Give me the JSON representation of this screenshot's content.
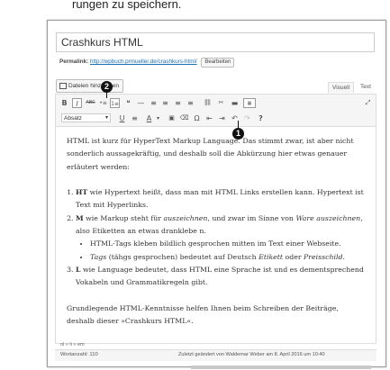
{
  "top_text": "rungen zu speichern.",
  "post": {
    "title": "Crashkurs HTML",
    "permalink_label": "Permalink:",
    "permalink_url": "http://wpbuch.prmueller.de/crashkurs-html/",
    "edit_label": "Bearbeiten"
  },
  "media_button": "Dateien hinzufügen",
  "tabs": {
    "visual": "Visuell",
    "text": "Text"
  },
  "toolbar": {
    "row1": [
      "B",
      "I",
      "ABC",
      "•≡",
      "1≡",
      "❝",
      "—",
      "≡",
      "≡",
      "≡",
      "🔗",
      "⛓",
      "▬",
      "⌨"
    ],
    "format_select": "Absatz",
    "row2": [
      "U",
      "≡",
      "A",
      "▾",
      "📋",
      "✎",
      "Ω",
      "⇤",
      "⇥",
      "↶",
      "↷",
      "?"
    ]
  },
  "callouts": {
    "one": "1",
    "two": "2"
  },
  "content": {
    "intro": "HTML ist kurz für HyperText Markup Language. Das stimmt zwar, ist aber nicht sonderlich aussagekräftig, und deshalb soll die Abkürzung hier etwas genauer erläutert werden:",
    "items": [
      {
        "bold": "HT",
        "text": " wie Hypertext heißt, dass man mit HTML Links erstellen kann. Hypertext ist Text mit Hyperlinks."
      },
      {
        "bold": "M",
        "text": " wie Markup steht für auszeichnen, und zwar im Sinne von Ware auszeichnen, also Etiketten an etwas drankleben."
      },
      {
        "bold": "L",
        "text": " wie Language bedeutet, dass HTML eine Sprache ist und es dementsprechend Vokabeln und Grammatikregeln gibt."
      }
    ],
    "m_part1": " wie Markup steht für ",
    "m_em1": "auszeichnen",
    "m_part2": ", und zwar im Sinne von ",
    "m_em2": "Ware auszeichnen",
    "m_part3": ", also Etiketten an etwas dranklebe n.",
    "sub1": "HTML-Tags kleben bildlich gesprochen mitten im Text einer Webseite.",
    "sub2_em": "Tags",
    "sub2_a": " (tähgs gesprochen) bedeutet auf Deutsch ",
    "sub2_em2": "Etikett",
    "sub2_b": " oder ",
    "sub2_em3": "Preisschild",
    "sub2_c": ".",
    "outro": "Grundlegende HTML-Kenntnisse helfen Ihnen beim Schreiben der Beiträge, deshalb dieser »Crashkurs HTML«."
  },
  "status": {
    "path": "ol » li » em",
    "word_count": "Wortanzahl: 110",
    "last_modified": "Zuletzt geändert von Waldemar Weber am 8. April 2016 um 10:40"
  }
}
